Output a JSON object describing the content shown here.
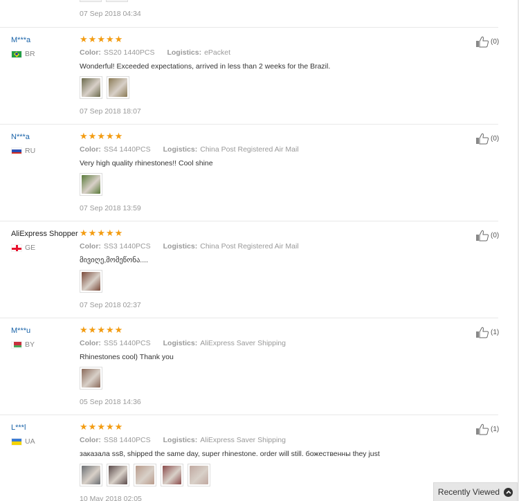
{
  "top_partial": {
    "date": "07 Sep 2018 04:34"
  },
  "reviews": [
    {
      "user": "M***a",
      "country": "BR",
      "flag": "br",
      "rating": 5,
      "color_label": "Color:",
      "color": "SS20 1440PCS",
      "logistics_label": "Logistics:",
      "logistics": "ePacket",
      "text": "Wonderful! Exceeded expectations, arrived in less than 2 weeks for the Brazil.",
      "photos": [
        "#6b6a4c",
        "#8a7a55"
      ],
      "date": "07 Sep 2018 18:07",
      "helpful": "(0)"
    },
    {
      "user": "N***a",
      "country": "RU",
      "flag": "ru",
      "rating": 5,
      "color_label": "Color:",
      "color": "SS4 1440PCS",
      "logistics_label": "Logistics:",
      "logistics": "China Post Registered Air Mail",
      "text": "Very high quality rhinestones!! Cool shine",
      "photos": [
        "#5a7a3a"
      ],
      "date": "07 Sep 2018 13:59",
      "helpful": "(0)"
    },
    {
      "user": "AliExpress Shopper",
      "country": "GE",
      "flag": "ge",
      "rating": 5,
      "color_label": "Color:",
      "color": "SS3 1440PCS",
      "logistics_label": "Logistics:",
      "logistics": "China Post Registered Air Mail",
      "text": "მივიღე,მომეწონა....",
      "photos": [
        "#7a4a3a"
      ],
      "date": "07 Sep 2018 02:37",
      "helpful": "(0)"
    },
    {
      "user": "M***u",
      "country": "BY",
      "flag": "by",
      "rating": 5,
      "color_label": "Color:",
      "color": "SS5 1440PCS",
      "logistics_label": "Logistics:",
      "logistics": "AliExpress Saver Shipping",
      "text": "Rhinestones cool) Thank you",
      "photos": [
        "#8a6a5a"
      ],
      "date": "05 Sep 2018 14:36",
      "helpful": "(1)"
    },
    {
      "user": "L***l",
      "country": "UA",
      "flag": "ua",
      "rating": 5,
      "color_label": "Color:",
      "color": "SS8 1440PCS",
      "logistics_label": "Logistics:",
      "logistics": "AliExpress Saver Shipping",
      "text": "заказала ss8, shipped the same day, super rhinestone. order will still. божественны they just",
      "photos": [
        "#6a6e72",
        "#5a4a4a",
        "#b89a8a",
        "#8a4a4a",
        "#c0a8a0"
      ],
      "date": "10 May 2018 02:05",
      "helpful": "(1)"
    }
  ],
  "recently_viewed": {
    "label": "Recently Viewed"
  },
  "colors": {
    "star": "#f39c12",
    "link": "#1862a8",
    "muted": "#999999"
  }
}
